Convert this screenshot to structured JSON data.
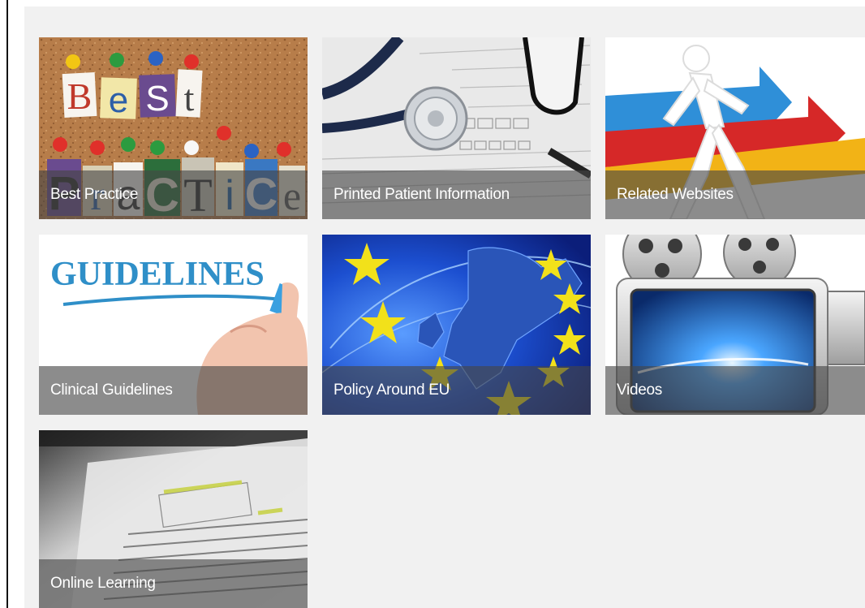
{
  "tiles": [
    {
      "id": "best-practice",
      "label": "Best Practice"
    },
    {
      "id": "printed-patient-information",
      "label": "Printed Patient Information"
    },
    {
      "id": "related-websites",
      "label": "Related Websites"
    },
    {
      "id": "clinical-guidelines",
      "label": "Clinical Guidelines"
    },
    {
      "id": "policy-around-eu",
      "label": "Policy Around EU"
    },
    {
      "id": "videos",
      "label": "Videos"
    },
    {
      "id": "online-learning",
      "label": "Online Learning"
    }
  ],
  "art_text": {
    "best": [
      "B",
      "e",
      "S",
      "t"
    ],
    "practice": [
      "P",
      "r",
      "a",
      "C",
      "T",
      "i",
      "C",
      "e"
    ],
    "guidelines": "GUIDELINES"
  },
  "colors": {
    "panel_background": "#f1f1f1",
    "caption_overlay": "#464646",
    "caption_text": "#ffffff"
  }
}
